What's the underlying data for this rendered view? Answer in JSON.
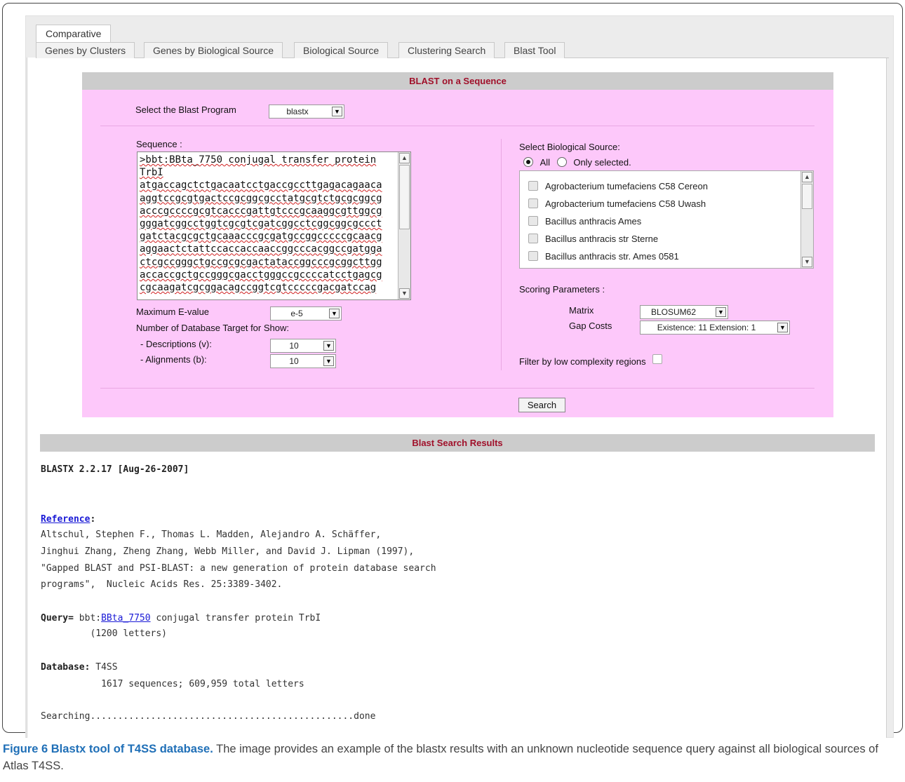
{
  "tabs": {
    "top": "Comparative",
    "sub": [
      "Genes by Clusters",
      "Genes by Biological Source",
      "Biological Source",
      "Clustering Search",
      "Blast Tool"
    ]
  },
  "blast": {
    "title": "BLAST on a Sequence",
    "program_label": "Select the Blast Program",
    "program_value": "blastx",
    "sequence_label": "Sequence :",
    "sequence_header_1": ">bbt:BBta_7750 conjugal transfer protein",
    "sequence_header_2": "TrbI",
    "sequence_lines": [
      "atgaccagctctgacaatcctgaccgccttgagacagaaca",
      "aggtccgcgtgactccgcggcgcctatgcgtctgcgcggcg",
      "acccgccccgcgtcacccgattgtcccgcaaggcgttggcg",
      "gggatcggcctggtcgcgtcgatcggcctcggcggcgccct",
      "gatctacgcgctgcaaacccgcgatgccggcccccgcaacg",
      "aggaactctattccaccaccaaccggcccacggccgatgga",
      "ctcgccgggctgccgcgcgactataccggcccgcggcttgg",
      "accaccgctgccgggcgacctgggccgccccatcctgagcg",
      "cgcaagatcgcggacagccggtcgtcccccgacgatccag"
    ],
    "evalue_label": "Maximum E-value",
    "evalue_value": "e-5",
    "targets_label": "Number of Database Target for Show:",
    "descriptions_label": "- Descriptions (v):",
    "descriptions_value": "10",
    "alignments_label": "- Alignments (b):",
    "alignments_value": "10",
    "source_label": "Select Biological Source:",
    "radio_all": "All",
    "radio_selected": "Only selected.",
    "sources": [
      "Agrobacterium tumefaciens C58 Cereon",
      "Agrobacterium tumefaciens C58 Uwash",
      "Bacillus anthracis Ames",
      "Bacillus anthracis str Sterne",
      "Bacillus anthracis str. Ames 0581"
    ],
    "scoring_label": "Scoring Parameters :",
    "matrix_label": "Matrix",
    "matrix_value": "BLOSUM62",
    "gap_label": "Gap Costs",
    "gap_value": "Existence: 11 Extension: 1",
    "filter_label": "Filter by low complexity regions",
    "search_button": "Search"
  },
  "results": {
    "title": "Blast Search Results",
    "version": "BLASTX 2.2.17 [Aug-26-2007]",
    "reference_link": "Reference",
    "reference_colon": ":",
    "reference_lines": [
      "Altschul, Stephen F., Thomas L. Madden, Alejandro A. Schäffer,",
      "Jinghui Zhang, Zheng Zhang, Webb Miller, and David J. Lipman (1997),",
      "\"Gapped BLAST and PSI-BLAST: a new generation of protein database search",
      "programs\",  Nucleic Acids Res. 25:3389-3402."
    ],
    "query_label": "Query=",
    "query_prefix": " bbt:",
    "query_link": "BBta_7750",
    "query_suffix": " conjugal transfer protein TrbI",
    "query_letters": "         (1200 letters)",
    "database_label": "Database:",
    "database_value": " T4SS",
    "database_stats": "           1617 sequences; 609,959 total letters",
    "searching": "Searching................................................done"
  },
  "caption": {
    "bold": "Figure 6 Blastx tool of T4SS database.",
    "text": " The image provides an example of the blastx results with an unknown nucleotide sequence query against all biological sources of Atlas T4SS."
  }
}
